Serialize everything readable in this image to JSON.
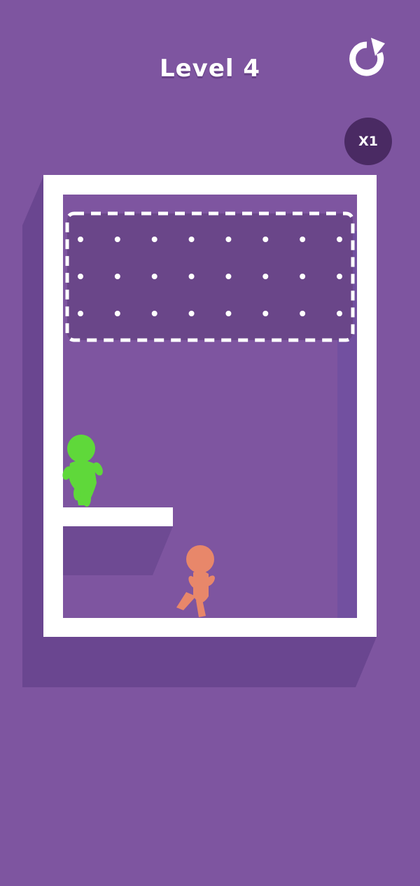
{
  "header": {
    "level_label": "Level 4",
    "restart_icon": "restart-icon",
    "multiplier_label": "X1"
  },
  "colors": {
    "background": "#7e55a0",
    "frame": "#ffffff",
    "shadow": "#6a4690",
    "drop_zone": "#6a4689",
    "green_character": "#5fd83a",
    "orange_character": "#e8876a",
    "badge": "#4a2a63"
  },
  "board": {
    "drop_zone": {
      "peg_rows": 3,
      "peg_columns": 8
    },
    "characters": [
      {
        "name": "green-character",
        "color": "green"
      },
      {
        "name": "orange-character",
        "color": "orange"
      }
    ]
  }
}
